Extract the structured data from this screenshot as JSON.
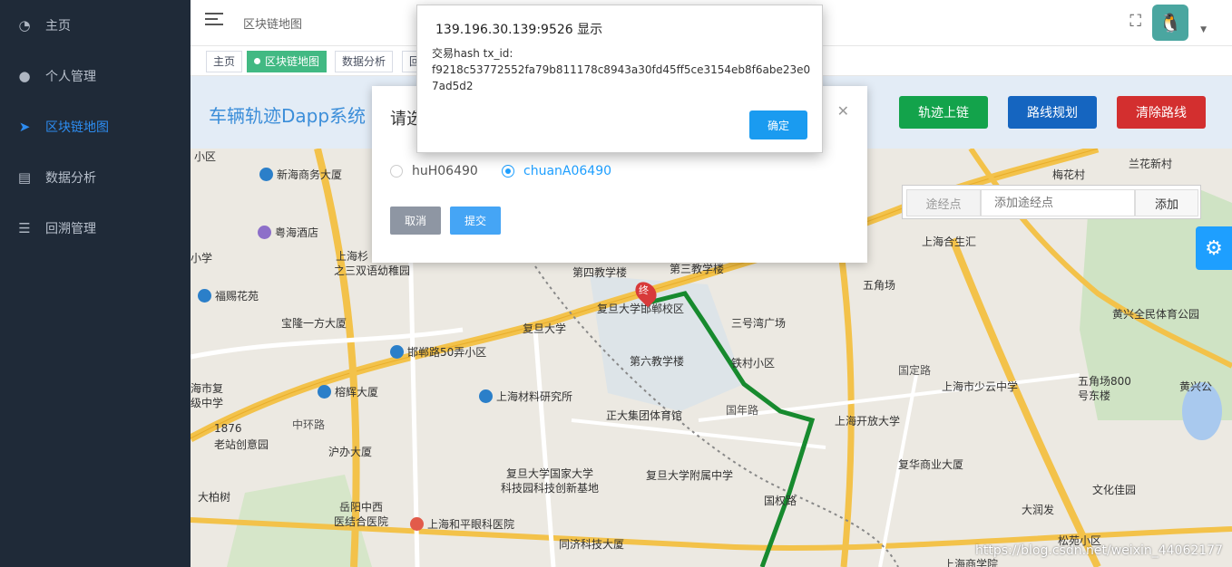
{
  "sidebar": {
    "items": [
      {
        "icon": "dashboard-icon",
        "label": "主页"
      },
      {
        "icon": "user-icon",
        "label": "个人管理"
      },
      {
        "icon": "send-icon",
        "label": "区块链地图"
      },
      {
        "icon": "chart-icon",
        "label": "数据分析"
      },
      {
        "icon": "list-icon",
        "label": "回溯管理"
      }
    ]
  },
  "header": {
    "breadcrumb": "区块链地图"
  },
  "tabs": [
    {
      "label": "主页"
    },
    {
      "label": "区块链地图"
    },
    {
      "label": "数据分析"
    },
    {
      "label": "回"
    }
  ],
  "page": {
    "title": "车辆轨迹Dapp系统",
    "buttons": {
      "upload": "轨迹上链",
      "plan": "路线规划",
      "clear": "清除路线"
    },
    "colors": {
      "green": "#13a34b",
      "blue": "#1565c0",
      "red": "#d32f2f"
    }
  },
  "waypoint": {
    "label": "途经点",
    "placeholder": "添加途经点",
    "add": "添加"
  },
  "map": {
    "pois": [
      "新海商务大厦",
      "粤海酒店",
      "上海杉",
      "之三双语幼稚园",
      "福赐花苑",
      "宝隆一方大厦",
      "邯郸路50弄小区",
      "榕辉大厦",
      "海市复",
      "级中学",
      "1876",
      "老站创意园",
      "沪办大厦",
      "大柏树",
      "岳阳中西",
      "医结合医院",
      "上海和平眼科医院",
      "同济科技大厦",
      "上海材料研究所",
      "正大集团体育馆",
      "复旦大学国家大学",
      "科技园科技创新基地",
      "复旦大学附属中学",
      "国权路",
      "第六教学楼",
      "铁村小区",
      "第四教学楼",
      "第三教学楼",
      "复旦大学",
      "复旦大学邯郸校区",
      "三号湾广场",
      "五角场",
      "上海合生汇",
      "上海开放大学",
      "上海市少云中学",
      "复华商业大厦",
      "五角场800",
      "号东楼",
      "黄兴全民体育公园",
      "黄兴公",
      "梅花村",
      "兰花新村",
      "中环路",
      "国定路",
      "国年路",
      "文化佳园",
      "大润发",
      "松苑小区",
      "上海商学院",
      "小区",
      "小学",
      "终"
    ],
    "watermark": "https://blog.csdn.net/weixin_44062177"
  },
  "dialog": {
    "title": "请选",
    "options": [
      {
        "label": "huH06490",
        "checked": false
      },
      {
        "label": "chuanA06490",
        "checked": true
      }
    ],
    "cancel": "取消",
    "submit": "提交"
  },
  "alert": {
    "title": "139.196.30.139:9526 显示",
    "message_label": "交易hash tx_id:",
    "message_value": "f9218c53772552fa79b811178c8943a30fd45ff5ce3154eb8f6abe23e07ad5d2",
    "ok": "确定"
  }
}
